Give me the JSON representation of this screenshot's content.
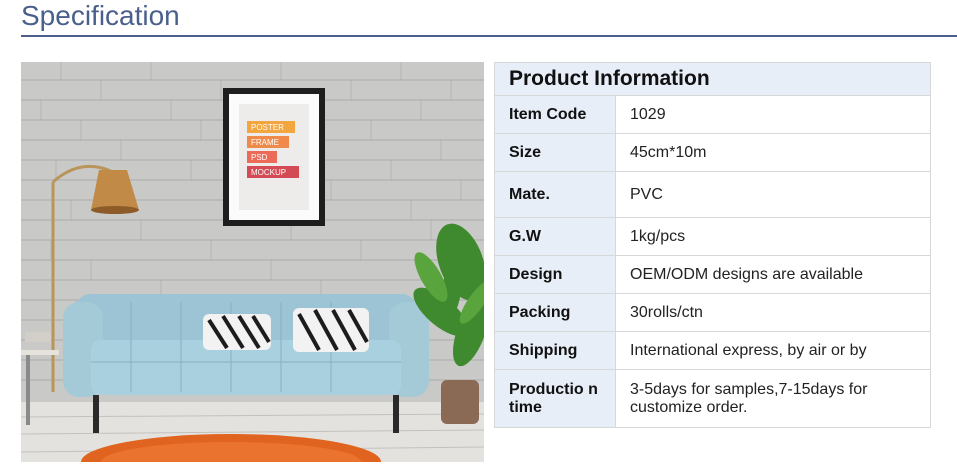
{
  "section_title": "Specification",
  "table": {
    "header": "Product Information",
    "rows": [
      {
        "label": "Item Code",
        "value": "1029"
      },
      {
        "label": "Size",
        "value": "45cm*10m"
      },
      {
        "label": "Mate.",
        "value": "PVC"
      },
      {
        "label": "G.W",
        "value": "1kg/pcs"
      },
      {
        "label": "Design",
        "value": "OEM/ODM designs are available"
      },
      {
        "label": "Packing",
        "value": "30rolls/ctn"
      },
      {
        "label": "Shipping",
        "value": "International express, by air or by"
      },
      {
        "label": "Productio n time",
        "value": "3-5days for samples,7-15days for customize order."
      }
    ]
  },
  "photo": {
    "poster_lines": [
      "POSTER",
      "FRAME",
      "PSD",
      "MOCKUP"
    ]
  }
}
